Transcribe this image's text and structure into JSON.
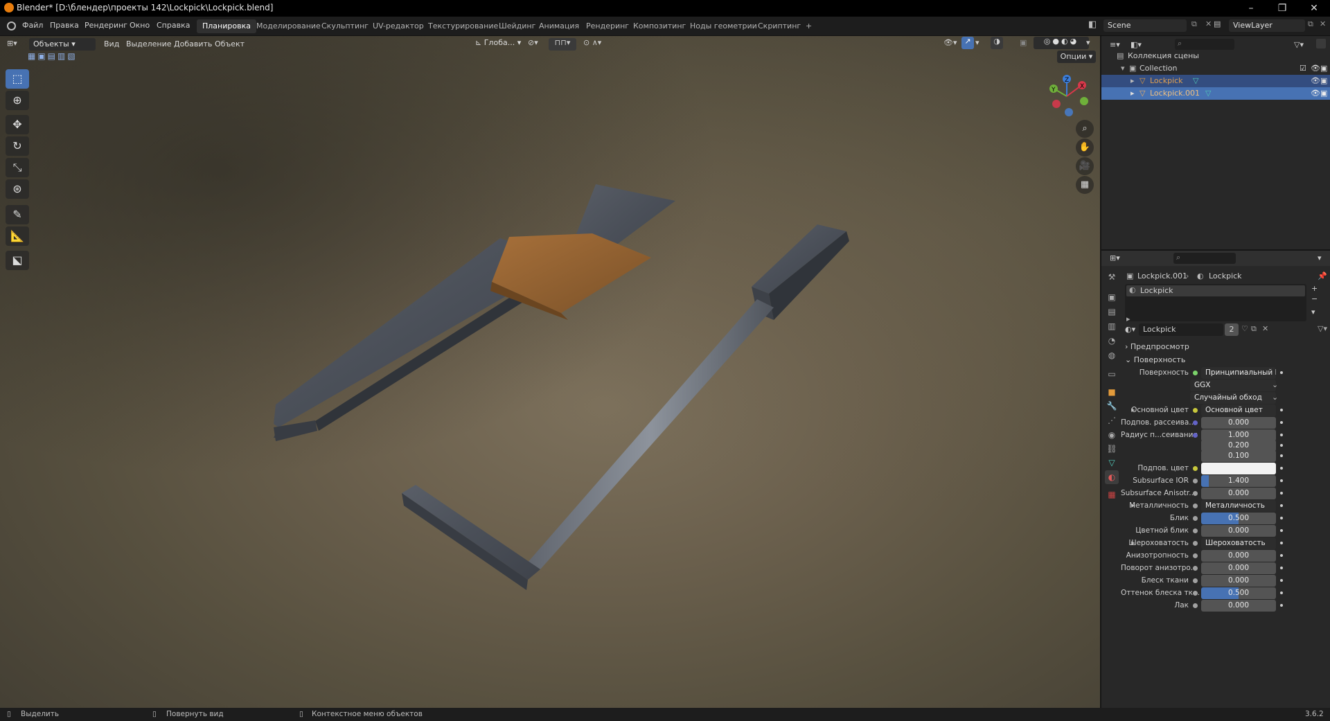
{
  "window": {
    "title": "Blender* [D:\\блендер\\проекты 142\\Lockpick\\Lockpick.blend]",
    "minimize": "–",
    "restore": "❐",
    "close": "✕"
  },
  "menubar": {
    "items": [
      "Файл",
      "Правка",
      "Рендеринг",
      "Окно",
      "Справка"
    ]
  },
  "workspaces": {
    "tabs": [
      "Планировка",
      "Моделирование",
      "Скульптинг",
      "UV-редактор",
      "Текстурирование",
      "Шейдинг",
      "Анимация",
      "Рендеринг",
      "Композитинг",
      "Ноды геометрии",
      "Скриптинг"
    ],
    "active": "Планировка",
    "add": "+"
  },
  "scene": {
    "label": "Scene",
    "viewlayer": "ViewLayer"
  },
  "viewport_header": {
    "mode": "Объекты",
    "menus": [
      "Вид",
      "Выделение",
      "Добавить",
      "Объект"
    ],
    "transform_orientation": "Глоба...",
    "options": "Опции"
  },
  "gizmo": {
    "x": "X",
    "y": "Y",
    "z": "Z"
  },
  "outliner": {
    "root": "Коллекция сцены",
    "collection": "Collection",
    "objects": [
      {
        "name": "Lockpick",
        "selected": true,
        "color": "#e0a050"
      },
      {
        "name": "Lockpick.001",
        "selected": true,
        "color": "#f0c080"
      }
    ]
  },
  "properties": {
    "breadcrumb": {
      "object": "Lockpick.001",
      "material": "Lockpick"
    },
    "slot": "Lockpick",
    "material_name": "Lockpick",
    "users": "2",
    "panels": {
      "preview": "Предпросмотр",
      "surface": "Поверхность"
    },
    "rows": [
      {
        "label": "Поверхность",
        "value": "Принципиальный BSDF",
        "kind": "link",
        "dot": "#7bd36a"
      },
      {
        "label": "",
        "value": "GGX",
        "kind": "dropdown"
      },
      {
        "label": "",
        "value": "Случайный обход",
        "kind": "dropdown"
      },
      {
        "label": "Основной цвет",
        "value": "Основной цвет",
        "kind": "link",
        "dot": "#c8c83c",
        "expand": true
      },
      {
        "label": "Подпов. рассеива...",
        "value": "0.000",
        "kind": "num",
        "dot": "#6363c7"
      },
      {
        "label": "Радиус п...сеивания",
        "value": "1.000",
        "kind": "num",
        "dot": "#6363c7"
      },
      {
        "label": "",
        "value": "0.200",
        "kind": "num"
      },
      {
        "label": "",
        "value": "0.100",
        "kind": "num"
      },
      {
        "label": "Подпов. цвет",
        "value": "",
        "kind": "color",
        "dot": "#c8c83c"
      },
      {
        "label": "Subsurface IOR",
        "value": "1.400",
        "kind": "num",
        "dot": "#a1a1a1",
        "fill": 0.1
      },
      {
        "label": "Subsurface Anisotr...",
        "value": "0.000",
        "kind": "num",
        "dot": "#a1a1a1"
      },
      {
        "label": "Металличность",
        "value": "Металличность",
        "kind": "link",
        "dot": "#a1a1a1",
        "expand": true
      },
      {
        "label": "Блик",
        "value": "0.500",
        "kind": "num",
        "dot": "#a1a1a1",
        "fill": 0.5
      },
      {
        "label": "Цветной блик",
        "value": "0.000",
        "kind": "num",
        "dot": "#a1a1a1"
      },
      {
        "label": "Шероховатость",
        "value": "Шероховатость",
        "kind": "link",
        "dot": "#a1a1a1",
        "expand": true
      },
      {
        "label": "Анизотропность",
        "value": "0.000",
        "kind": "num",
        "dot": "#a1a1a1"
      },
      {
        "label": "Поворот анизотро...",
        "value": "0.000",
        "kind": "num",
        "dot": "#a1a1a1"
      },
      {
        "label": "Блеск ткани",
        "value": "0.000",
        "kind": "num",
        "dot": "#a1a1a1"
      },
      {
        "label": "Оттенок блеска тк...",
        "value": "0.500",
        "kind": "num",
        "dot": "#a1a1a1",
        "fill": 0.5
      },
      {
        "label": "Лак",
        "value": "0.000",
        "kind": "num",
        "dot": "#a1a1a1"
      }
    ]
  },
  "statusbar": {
    "select": "Выделить",
    "rotate": "Повернуть вид",
    "context": "Контекстное меню объектов",
    "version": "3.6.2"
  }
}
